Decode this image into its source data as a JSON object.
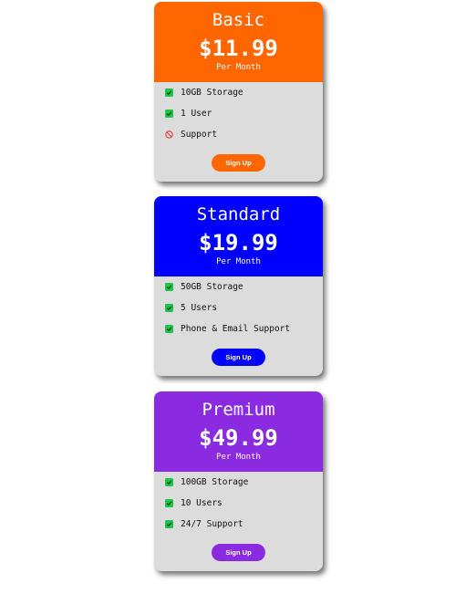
{
  "colors": {
    "basic": "#ff6600",
    "standard": "#0000ff",
    "premium": "#8a2be2",
    "card_body": "#dcdcdc",
    "check": "#1cc44a",
    "blocked": "#e53935"
  },
  "plans": [
    {
      "name": "Basic",
      "price": "$11.99",
      "period": "Per Month",
      "features": [
        {
          "text": "10GB Storage",
          "icon": "check-icon"
        },
        {
          "text": "1 User",
          "icon": "check-icon"
        },
        {
          "text": "Support",
          "icon": "blocked-icon"
        }
      ],
      "button": "Sign Up"
    },
    {
      "name": "Standard",
      "price": "$19.99",
      "period": "Per Month",
      "features": [
        {
          "text": "50GB Storage",
          "icon": "check-icon"
        },
        {
          "text": "5 Users",
          "icon": "check-icon"
        },
        {
          "text": "Phone & Email Support",
          "icon": "check-icon"
        }
      ],
      "button": "Sign Up"
    },
    {
      "name": "Premium",
      "price": "$49.99",
      "period": "Per Month",
      "features": [
        {
          "text": "100GB Storage",
          "icon": "check-icon"
        },
        {
          "text": "10 Users",
          "icon": "check-icon"
        },
        {
          "text": "24/7 Support",
          "icon": "check-icon"
        }
      ],
      "button": "Sign Up"
    }
  ]
}
